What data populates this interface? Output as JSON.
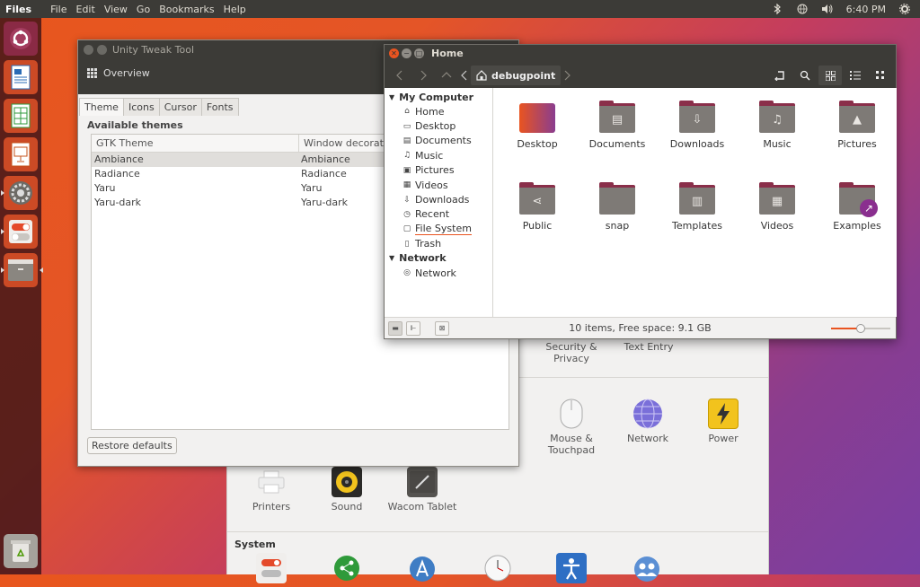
{
  "top_panel": {
    "app_name": "Files",
    "menus": [
      "File",
      "Edit",
      "View",
      "Go",
      "Bookmarks",
      "Help"
    ],
    "clock": "6:40 PM"
  },
  "launcher": {
    "items": [
      "ubuntu-logo",
      "libreoffice-writer",
      "libreoffice-calc",
      "libreoffice-impress",
      "system-settings",
      "unity-tweak-tool",
      "files"
    ],
    "trash": "trash"
  },
  "settings": {
    "row1": [
      "Security &\nPrivacy",
      "Text Entry"
    ],
    "row2": [
      "Mouse &\nTouchpad",
      "Network",
      "Power"
    ],
    "row3": [
      "Printers",
      "Sound",
      "Wacom Tablet"
    ],
    "section_system": "System"
  },
  "tweak": {
    "title": "Unity Tweak Tool",
    "overview": "Overview",
    "tabs": [
      "Theme",
      "Icons",
      "Cursor",
      "Fonts"
    ],
    "available_themes": "Available themes",
    "columns": [
      "GTK Theme",
      "Window decoration"
    ],
    "rows": [
      [
        "Ambiance",
        "Ambiance"
      ],
      [
        "Radiance",
        "Radiance"
      ],
      [
        "Yaru",
        "Yaru"
      ],
      [
        "Yaru-dark",
        "Yaru-dark"
      ]
    ],
    "restore": "Restore defaults"
  },
  "nautilus": {
    "title": "Home",
    "breadcrumb": "debugpoint",
    "sidebar": {
      "my_computer": "My Computer",
      "computer_items": [
        "Home",
        "Desktop",
        "Documents",
        "Music",
        "Pictures",
        "Videos",
        "Downloads",
        "Recent",
        "File System",
        "Trash"
      ],
      "network_head": "Network",
      "network_items": [
        "Network"
      ]
    },
    "folders": [
      "Desktop",
      "Documents",
      "Downloads",
      "Music",
      "Pictures",
      "Public",
      "snap",
      "Templates",
      "Videos",
      "Examples"
    ],
    "status": "10 items, Free space: 9.1 GB",
    "zoom_level": 0.5
  },
  "colors": {
    "accent": "#e95420",
    "folder_tab": "#8a2f4a",
    "folder_body": "#7e7a76"
  }
}
